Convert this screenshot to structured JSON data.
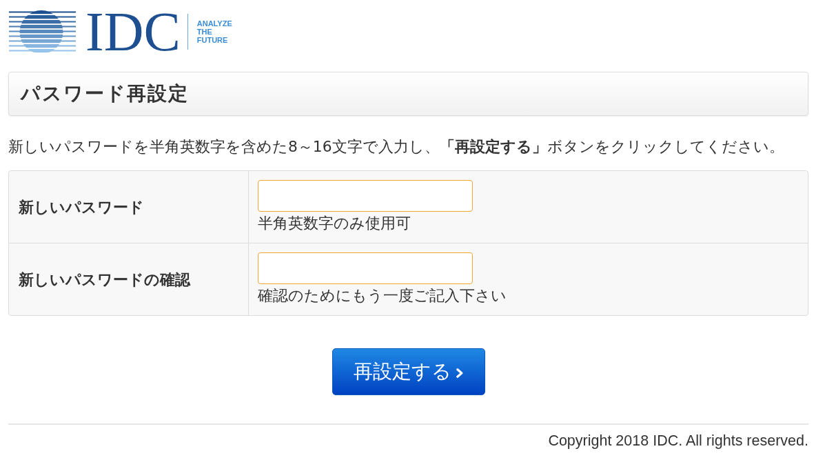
{
  "logo": {
    "wordmark": "IDC",
    "tagline": "ANALYZE THE FUTURE"
  },
  "page_title": "パスワード再設定",
  "instruction": "新しいパスワードを半角英数字を含めた8～16文字で入力し、**「再設定する」**ボタンをクリックしてください。",
  "form": {
    "rows": [
      {
        "label": "新しいパスワード",
        "hint": "半角英数字のみ使用可"
      },
      {
        "label": "新しいパスワードの確認",
        "hint": "確認のためにもう一度ご記入下さい"
      }
    ]
  },
  "submit_button": {
    "label": "再設定する"
  },
  "footer": {
    "copyright": "Copyright 2018 IDC. All rights reserved."
  }
}
